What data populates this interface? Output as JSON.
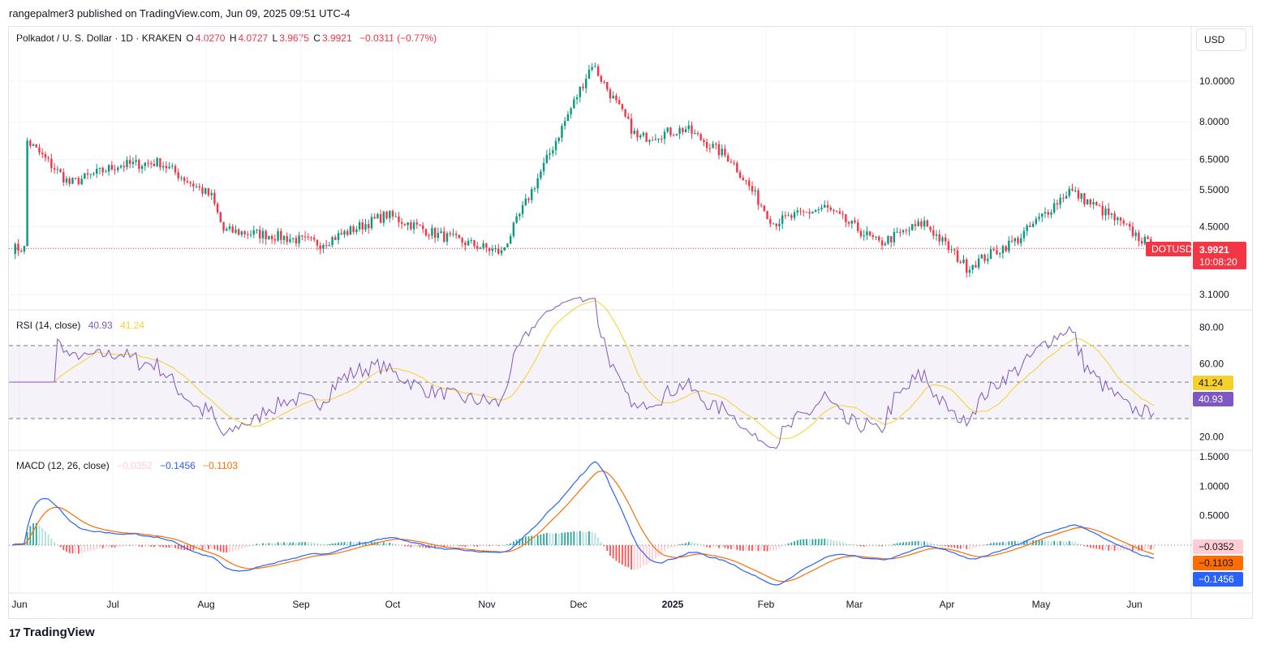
{
  "publisher": "rangepalmer3 published on TradingView.com, Jun 09, 2025 09:51 UTC-4",
  "symbol_title": "Polkadot / U. S. Dollar · 1D · KRAKEN",
  "ohlc": {
    "o_label": "O",
    "o": "4.0270",
    "h_label": "H",
    "h": "4.0727",
    "l_label": "L",
    "l": "3.9675",
    "c_label": "C",
    "c": "3.9921",
    "change": "−0.0311 (−0.77%)"
  },
  "currency_button": "USD",
  "ticker_tag": "DOTUSD",
  "last_price": "3.9921",
  "countdown": "10:08:20",
  "rsi_legend": {
    "name": "RSI (14, close)",
    "rsi": "40.93",
    "ma": "41.24"
  },
  "macd_legend": {
    "name": "MACD (12, 26, close)",
    "hist": "−0.0352",
    "macd": "−0.1456",
    "signal": "−0.1103"
  },
  "footer_brand": "TradingView",
  "logo_mark": "17",
  "colors": {
    "up": "#089981",
    "down": "#f23645",
    "rsi": "#7e57c2",
    "rsi_ma": "#f7d02c",
    "macd": "#2962ff",
    "signal": "#ff6d00",
    "hist_up_dark": "#26a69a",
    "hist_up_light": "#b2dfdb",
    "hist_down_dark": "#ff5252",
    "hist_down_light": "#ffcdd2"
  },
  "chart_data": [
    {
      "type": "candlestick",
      "title": "Polkadot / U. S. Dollar · 1D · KRAKEN",
      "scale": "log",
      "y_ticks": [
        "10.0000",
        "8.0000",
        "6.5000",
        "5.5000",
        "4.5000",
        "3.1000"
      ],
      "x_ticks": [
        "Jun",
        "Jul",
        "Aug",
        "Sep",
        "Oct",
        "Nov",
        "Dec",
        "2025",
        "Feb",
        "Mar",
        "Apr",
        "May",
        "Jun"
      ],
      "approx_series": {
        "x": [
          "2024-06-01",
          "2024-06-15",
          "2024-07-01",
          "2024-07-15",
          "2024-08-01",
          "2024-08-05",
          "2024-08-20",
          "2024-09-06",
          "2024-09-28",
          "2024-10-15",
          "2024-11-05",
          "2024-11-20",
          "2024-12-05",
          "2024-12-20",
          "2025-01-05",
          "2025-01-20",
          "2025-02-03",
          "2025-02-20",
          "2025-03-10",
          "2025-03-25",
          "2025-04-08",
          "2025-04-25",
          "2025-05-12",
          "2025-05-25",
          "2025-06-09"
        ],
        "close": [
          7.2,
          5.7,
          6.3,
          6.4,
          5.3,
          4.4,
          4.3,
          4.1,
          4.8,
          4.3,
          3.9,
          6.5,
          11.0,
          7.3,
          7.7,
          6.5,
          4.6,
          5.0,
          4.1,
          4.6,
          3.6,
          4.2,
          5.5,
          4.8,
          3.9921
        ]
      },
      "last": 3.9921
    },
    {
      "type": "line",
      "title": "RSI (14, close)",
      "y_ticks": [
        "80.00",
        "60.00",
        "20.00"
      ],
      "band": [
        30,
        70
      ],
      "series": [
        {
          "name": "RSI",
          "last": 40.93
        },
        {
          "name": "RSI MA",
          "last": 41.24
        }
      ]
    },
    {
      "type": "line",
      "title": "MACD (12, 26, close)",
      "y_ticks": [
        "1.5000",
        "1.0000",
        "0.5000"
      ],
      "series": [
        {
          "name": "Histogram",
          "last": -0.0352
        },
        {
          "name": "MACD",
          "last": -0.1456
        },
        {
          "name": "Signal",
          "last": -0.1103
        }
      ]
    }
  ]
}
